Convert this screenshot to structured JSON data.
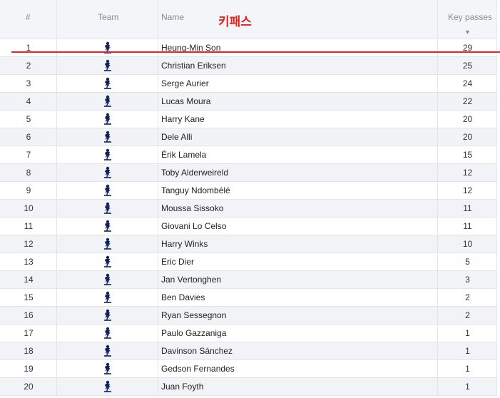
{
  "header": {
    "rank": "#",
    "team": "Team",
    "name": "Name",
    "key_passes": "Key passes",
    "sort_indicator": "▼"
  },
  "annotation": {
    "text": "키패스",
    "color": "#e8231f"
  },
  "team_crest": "tottenham-crest-icon",
  "rows": [
    {
      "rank": "1",
      "name": "Heung-Min Son",
      "kp": "29"
    },
    {
      "rank": "2",
      "name": "Christian Eriksen",
      "kp": "25"
    },
    {
      "rank": "3",
      "name": "Serge Aurier",
      "kp": "24"
    },
    {
      "rank": "4",
      "name": "Lucas Moura",
      "kp": "22"
    },
    {
      "rank": "5",
      "name": "Harry Kane",
      "kp": "20"
    },
    {
      "rank": "6",
      "name": "Dele Alli",
      "kp": "20"
    },
    {
      "rank": "7",
      "name": "Érik Lamela",
      "kp": "15"
    },
    {
      "rank": "8",
      "name": "Toby Alderweireld",
      "kp": "12"
    },
    {
      "rank": "9",
      "name": "Tanguy Ndombélé",
      "kp": "12"
    },
    {
      "rank": "10",
      "name": "Moussa Sissoko",
      "kp": "11"
    },
    {
      "rank": "11",
      "name": "Giovani Lo Celso",
      "kp": "11"
    },
    {
      "rank": "12",
      "name": "Harry Winks",
      "kp": "10"
    },
    {
      "rank": "13",
      "name": "Eric Dier",
      "kp": "5"
    },
    {
      "rank": "14",
      "name": "Jan Vertonghen",
      "kp": "3"
    },
    {
      "rank": "15",
      "name": "Ben Davies",
      "kp": "2"
    },
    {
      "rank": "16",
      "name": "Ryan Sessegnon",
      "kp": "2"
    },
    {
      "rank": "17",
      "name": "Paulo Gazzaniga",
      "kp": "1"
    },
    {
      "rank": "18",
      "name": "Davinson Sánchez",
      "kp": "1"
    },
    {
      "rank": "19",
      "name": "Gedson Fernandes",
      "kp": "1"
    },
    {
      "rank": "20",
      "name": "Juan Foyth",
      "kp": "1"
    }
  ]
}
